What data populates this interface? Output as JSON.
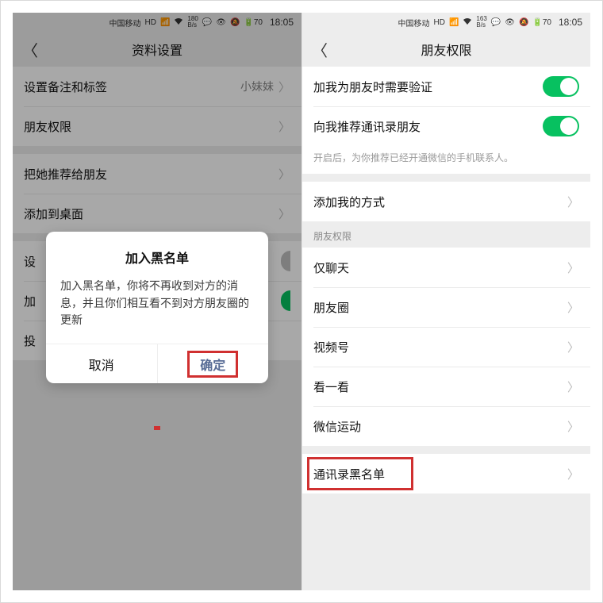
{
  "status": {
    "carrier": "中国移动",
    "hd": "HD",
    "signal": "⁴ᴳ",
    "wifi": "📶",
    "rate_up": "180",
    "rate_unit": "B/s",
    "rate_up_r": "163",
    "icons": "💬",
    "extra": "👁 🔕",
    "battery": "70",
    "time": "18:05"
  },
  "left": {
    "header": "资料设置",
    "rows": {
      "remark": "设置备注和标签",
      "remark_val": "小妹妹",
      "perm": "朋友权限",
      "recommend": "把她推荐给朋友",
      "desktop": "添加到桌面",
      "star_partial": "设",
      "addbl_partial": "加",
      "report_partial": "投"
    },
    "dialog": {
      "title": "加入黑名单",
      "msg": "加入黑名单，你将不再收到对方的消息，并且你们相互看不到对方朋友圈的更新",
      "cancel": "取消",
      "confirm": "确定"
    }
  },
  "right": {
    "header": "朋友权限",
    "verify": "加我为朋友时需要验证",
    "recommend_contacts": "向我推荐通讯录朋友",
    "recommend_sub": "开启后，为你推荐已经开通微信的手机联系人。",
    "add_method": "添加我的方式",
    "section": "朋友权限",
    "chat_only": "仅聊天",
    "moments": "朋友圈",
    "channels": "视频号",
    "topstories": "看一看",
    "werun": "微信运动",
    "blacklist": "通讯录黑名单"
  }
}
